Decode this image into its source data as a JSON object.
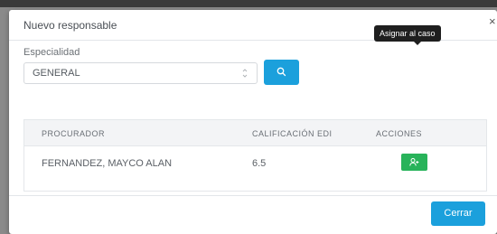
{
  "modal": {
    "title": "Nuevo responsable",
    "close_symbol": "×"
  },
  "form": {
    "specialty_label": "Especialidad",
    "specialty_value": "GENERAL",
    "search_icon": "search-icon"
  },
  "table": {
    "headers": [
      "PROCURADOR",
      "CALIFICACIÓN EDI",
      "ACCIONES"
    ],
    "rows": [
      {
        "procurador": "FERNANDEZ, MAYCO ALAN",
        "calificacion": "6.5",
        "action_icon": "user-add-icon"
      }
    ]
  },
  "tooltip": {
    "text": "Asignar al caso"
  },
  "footer": {
    "close_label": "Cerrar"
  },
  "colors": {
    "primary": "#1ba0dc",
    "success": "#28b35a",
    "tooltip_bg": "#1f1f1f"
  }
}
